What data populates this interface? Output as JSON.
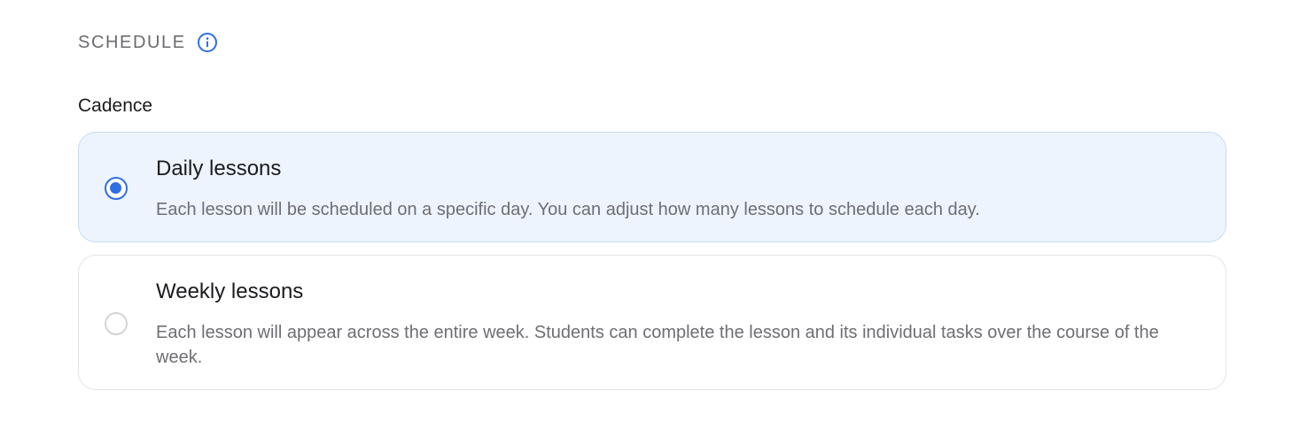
{
  "schedule": {
    "title": "SCHEDULE",
    "info_icon": "info-icon",
    "cadence_label": "Cadence",
    "accent_color": "#2e6fe6",
    "options": [
      {
        "id": "daily",
        "title": "Daily lessons",
        "description": "Each lesson will be scheduled on a specific day. You can adjust how many lessons to schedule each day.",
        "selected": true
      },
      {
        "id": "weekly",
        "title": "Weekly lessons",
        "description": "Each lesson will appear across the entire week. Students can complete the lesson and its individual tasks over the course of the week.",
        "selected": false
      }
    ]
  }
}
